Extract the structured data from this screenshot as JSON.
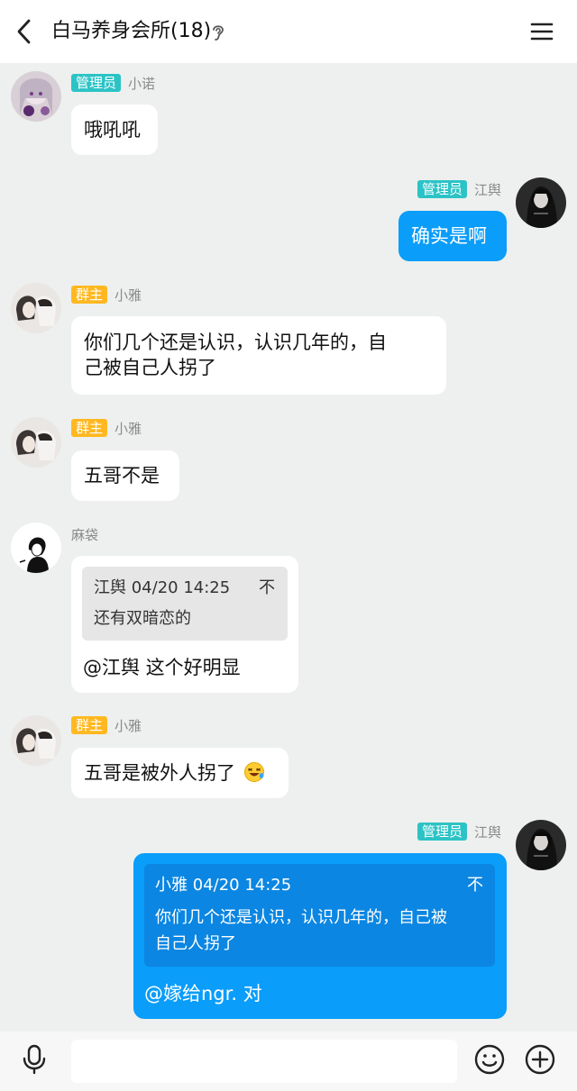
{
  "header": {
    "title": "白马养身会所(18)",
    "back_icon": "chevron-left-icon",
    "ear_icon": "ear-icon",
    "menu_icon": "hamburger-menu-icon"
  },
  "colors": {
    "admin_badge": "#2cc3c6",
    "owner_badge": "#ffb821",
    "outgoing_bubble": "#0a9dfa",
    "background": "#edf0ee"
  },
  "messages": [
    {
      "side": "left",
      "badge": "管理员",
      "badge_type": "admin",
      "name": "小诺",
      "text": "哦吼吼"
    },
    {
      "side": "right",
      "badge": "管理员",
      "badge_type": "admin",
      "name": "江舆",
      "text": "确实是啊"
    },
    {
      "side": "left",
      "badge": "群主",
      "badge_type": "owner",
      "name": "小雅",
      "text_lines": [
        "你们几个还是认识，认识几年的，自",
        "己被自己人拐了"
      ]
    },
    {
      "side": "left",
      "badge": "群主",
      "badge_type": "owner",
      "name": "小雅",
      "text": "五哥不是"
    },
    {
      "side": "left",
      "badge": "",
      "name": "麻袋",
      "quote": {
        "header": "江舆 04/20 14:25",
        "mark": "不",
        "text": "还有双暗恋的"
      },
      "text": "@江舆 这个好明显"
    },
    {
      "side": "left",
      "badge": "群主",
      "badge_type": "owner",
      "name": "小雅",
      "text": "五哥是被外人拐了",
      "emoji": "laughing-emoji"
    },
    {
      "side": "right",
      "badge": "管理员",
      "badge_type": "admin",
      "name": "江舆",
      "quote": {
        "header": "小雅 04/20 14:25",
        "mark": "不",
        "text_lines": [
          "你们几个还是认识，认识几年的，自己被",
          "自己人拐了"
        ]
      },
      "text": "@嫁给ngr. 对"
    }
  ],
  "footer": {
    "input_value": "",
    "voice_icon": "microphone-icon",
    "emoji_icon": "smiley-icon",
    "add_icon": "plus-circle-icon"
  }
}
